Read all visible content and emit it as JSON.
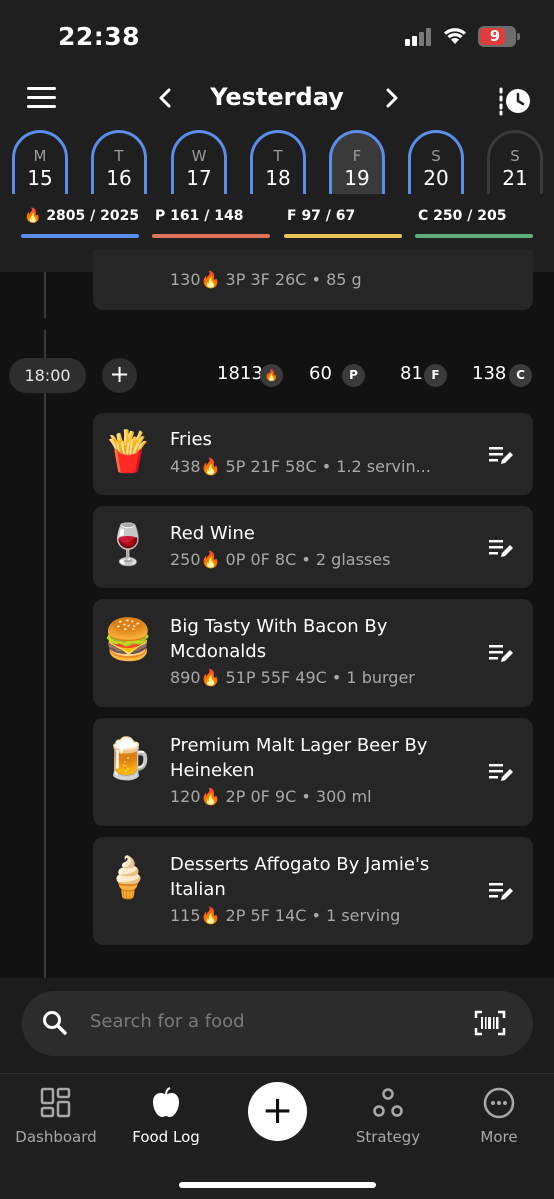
{
  "status": {
    "time": "22:38",
    "battery": "9"
  },
  "header": {
    "title": "Yesterday",
    "days": [
      {
        "letter": "M",
        "num": "15"
      },
      {
        "letter": "T",
        "num": "16"
      },
      {
        "letter": "W",
        "num": "17"
      },
      {
        "letter": "T",
        "num": "18"
      },
      {
        "letter": "F",
        "num": "19"
      },
      {
        "letter": "S",
        "num": "20"
      },
      {
        "letter": "S",
        "num": "21"
      }
    ],
    "macros": {
      "cal": "2805 / 2025",
      "p": "P 161 / 148",
      "f": "F 97 / 67",
      "c": "C 250 / 205"
    },
    "colors": {
      "cal": "#5b8dea",
      "p": "#e0725a",
      "f": "#e6c45a",
      "c": "#5fae7a"
    }
  },
  "prev_item": {
    "meta": "130🔥 3P  3F  26C • 85 g"
  },
  "meal": {
    "time": "18:00",
    "calories": "1813",
    "protein": "60",
    "fat": "81",
    "carbs": "138",
    "badges": {
      "p": "P",
      "f": "F",
      "c": "C"
    }
  },
  "items": [
    {
      "name": "Fries",
      "meta": "438🔥 5P  21F  58C • 1.2 servin...",
      "icon": "fries-icon",
      "emoji": "🍟"
    },
    {
      "name": "Red Wine",
      "meta": "250🔥 0P  0F  8C • 2 glasses",
      "icon": "wine-icon",
      "emoji": "🍷"
    },
    {
      "name": "Big Tasty With Bacon By Mcdonalds",
      "meta": "890🔥 51P  55F  49C • 1 burger",
      "icon": "burger-icon",
      "emoji": "🍔"
    },
    {
      "name": "Premium Malt Lager Beer By Heineken",
      "meta": "120🔥 2P  0F  9C • 300 ml",
      "icon": "beer-icon",
      "emoji": "🍺"
    },
    {
      "name": "Desserts Affogato By Jamie's Italian",
      "meta": "115🔥 2P  5F  14C • 1 serving",
      "icon": "icecream-icon",
      "emoji": "🍦"
    }
  ],
  "search": {
    "placeholder": "Search for a food"
  },
  "tabs": {
    "dashboard": "Dashboard",
    "food_log": "Food Log",
    "strategy": "Strategy",
    "more": "More"
  }
}
